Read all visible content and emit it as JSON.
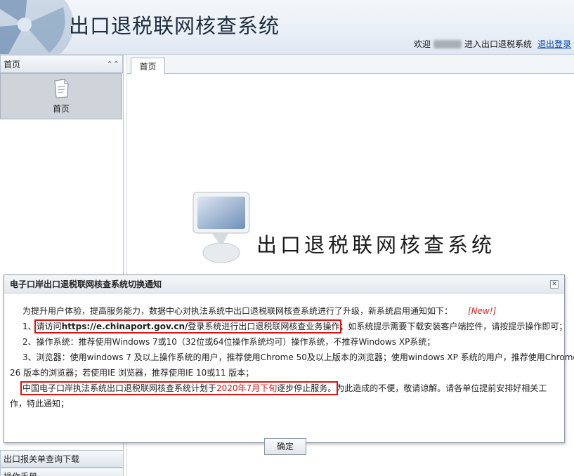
{
  "header": {
    "title": "出口退税联网核查系统",
    "welcome_prefix": "欢迎",
    "welcome_suffix": "进入出口退税系统",
    "logout": "退出登录"
  },
  "sidebar": {
    "section_title": "首页",
    "home_tile_label": "首页",
    "bottom_items": [
      "出口报关单查询下载",
      "操作手册"
    ]
  },
  "main": {
    "tab_label": "首页",
    "welcome_title": "出口退税联网核查系统"
  },
  "notice": {
    "title": "电子口岸出口退税联网核查系统切换通知",
    "intro": "为提升用户体验，提高服务能力，数据中心对执法系统中出口退税联网核查系统进行了升级，新系统启用通知如下：",
    "new_badge": "[New!]",
    "item1_num": "1、",
    "item1_pre": "请访问",
    "item1_url": "https://e.chinaport.gov.cn/",
    "item1_post": "登录系统进行出口退税联网核查业务操作",
    "item1_tail": "；如系统提示需要下载安装客户端控件，请按提示操作即可；",
    "item2": "2、操作系统：推荐使用Windows 7或10（32位或64位操作系统均可）操作系统，不推荐Windows XP系统；",
    "item3_a": "3、浏览器：使用windows 7 及以上操作系统的用户，推荐使用Chrome 50及以上版本的浏览器；使用windows XP 系统的用户，推荐使用Chrome",
    "item3_b": "26 版本的浏览器；若使用IE 浏览器，推荐使用IE 10或11 版本；",
    "stop_pre": "中国电子口岸执法系统出口退税联网核查系统计划于",
    "stop_date": "2020年7月下旬",
    "stop_post": "逐步停止服务。",
    "stop_tail": "为此造成的不便，敬请谅解。请各单位提前安排好相关工",
    "stop_tail2": "作，特此通知；",
    "ok_button": "确定"
  },
  "colors": {
    "highlight_box": "#e01010",
    "new_badge": "#e52020",
    "link": "#0645ad"
  }
}
